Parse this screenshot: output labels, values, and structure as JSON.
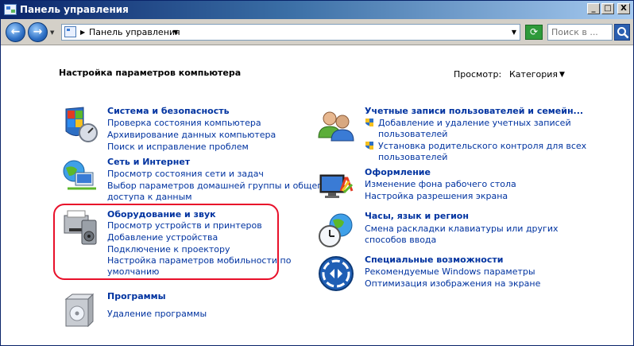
{
  "window": {
    "title": "Панель управления",
    "buttons": {
      "minimize": "_",
      "maximize": "□",
      "close": "X"
    }
  },
  "toolbar": {
    "address_text": "Панель управления",
    "search_placeholder": "Поиск в ...",
    "back_glyph": "←",
    "forward_glyph": "→",
    "refresh_glyph": "⟳"
  },
  "page": {
    "title": "Настройка параметров компьютера",
    "view_label": "Просмотр:",
    "view_value": "Категория"
  },
  "categories": {
    "security": {
      "title": "Система и безопасность",
      "links": [
        "Проверка состояния компьютера",
        "Архивирование данных компьютера",
        "Поиск и исправление проблем"
      ]
    },
    "network": {
      "title": "Сеть и Интернет",
      "links": [
        "Просмотр состояния сети и задач",
        "Выбор параметров домашней группы и общего",
        "доступа к данным"
      ]
    },
    "hardware": {
      "title": "Оборудование и звук",
      "links": [
        "Просмотр устройств и принтеров",
        "Добавление устройства",
        "Подключение к проектору",
        "Настройка параметров мобильности по",
        "умолчанию"
      ]
    },
    "programs": {
      "title": "Программы",
      "links": [
        "Удаление программы"
      ]
    },
    "accounts": {
      "title": "Учетные записи пользователей и семейн...",
      "links": [
        "Добавление и удаление учетных записей",
        "пользователей",
        "Установка родительского контроля для всех",
        "пользователей"
      ]
    },
    "appearance": {
      "title": "Оформление",
      "links": [
        "Изменение фона рабочего стола",
        "Настройка разрешения экрана"
      ]
    },
    "clock": {
      "title": "Часы, язык и регион",
      "links": [
        "Смена раскладки клавиатуры или других",
        "способов ввода"
      ]
    },
    "access": {
      "title": "Специальные возможности",
      "links": [
        "Рекомендуемые Windows параметры",
        "Оптимизация изображения на экране"
      ]
    }
  },
  "colors": {
    "link": "#0033a0",
    "highlight": "#e8102a",
    "titlebar": "#0a246a"
  }
}
